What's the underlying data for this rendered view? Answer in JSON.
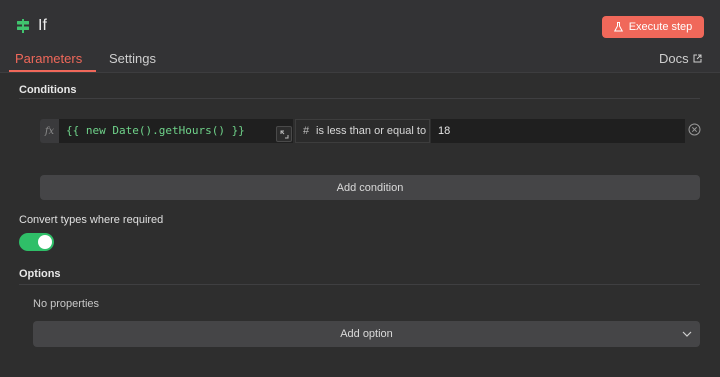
{
  "header": {
    "title": "If",
    "execute_label": "Execute step",
    "icon": "signpost-icon",
    "accent_color": "#f0685a"
  },
  "tabs": [
    {
      "label": "Parameters",
      "active": true
    },
    {
      "label": "Settings",
      "active": false
    }
  ],
  "docs_label": "Docs",
  "conditions": {
    "label": "Conditions",
    "rows": [
      {
        "fx_label": "fx",
        "expression": "{{ new Date().getHours() }}",
        "operator_symbol": "#",
        "operator": "is less than or equal to",
        "value": "18"
      }
    ],
    "add_label": "Add condition"
  },
  "convert_types": {
    "label": "Convert types where required",
    "enabled": true,
    "on_color": "#2fbf68"
  },
  "options": {
    "label": "Options",
    "empty_text": "No properties",
    "add_label": "Add option"
  }
}
